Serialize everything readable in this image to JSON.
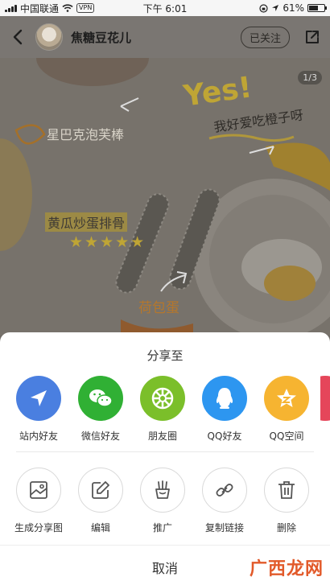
{
  "status_bar": {
    "carrier": "中国联通",
    "vpn": "VPN",
    "time": "下午 6:01",
    "battery": "61%",
    "battery_level": 0.61
  },
  "nav": {
    "username": "焦糖豆花儿",
    "follow_label": "已关注"
  },
  "photo": {
    "page_indicator": "1/3",
    "doodles": {
      "yes": "Yes!",
      "left_top": "星巴克泡芙棒",
      "right_top": "我好爱吃橙子呀",
      "middle": "黄瓜炒蛋排骨",
      "stars": "★★★★★",
      "bottom": "荷包蛋"
    }
  },
  "share_sheet": {
    "title": "分享至",
    "targets": [
      {
        "label": "站内好友",
        "color": "#4a7fe0",
        "icon": "send-icon"
      },
      {
        "label": "微信好友",
        "color": "#30b034",
        "icon": "wechat-icon"
      },
      {
        "label": "朋友圈",
        "color": "#7bbf2a",
        "icon": "moments-icon"
      },
      {
        "label": "QQ好友",
        "color": "#2d96f0",
        "icon": "qq-icon"
      },
      {
        "label": "QQ空间",
        "color": "#f6b431",
        "icon": "qzone-icon"
      }
    ],
    "actions": [
      {
        "label": "生成分享图",
        "icon": "image-icon"
      },
      {
        "label": "编辑",
        "icon": "edit-icon"
      },
      {
        "label": "推广",
        "icon": "promote-icon"
      },
      {
        "label": "复制链接",
        "icon": "link-icon"
      },
      {
        "label": "删除",
        "icon": "trash-icon"
      }
    ],
    "cancel_label": "取消"
  },
  "watermark": "广西龙网"
}
